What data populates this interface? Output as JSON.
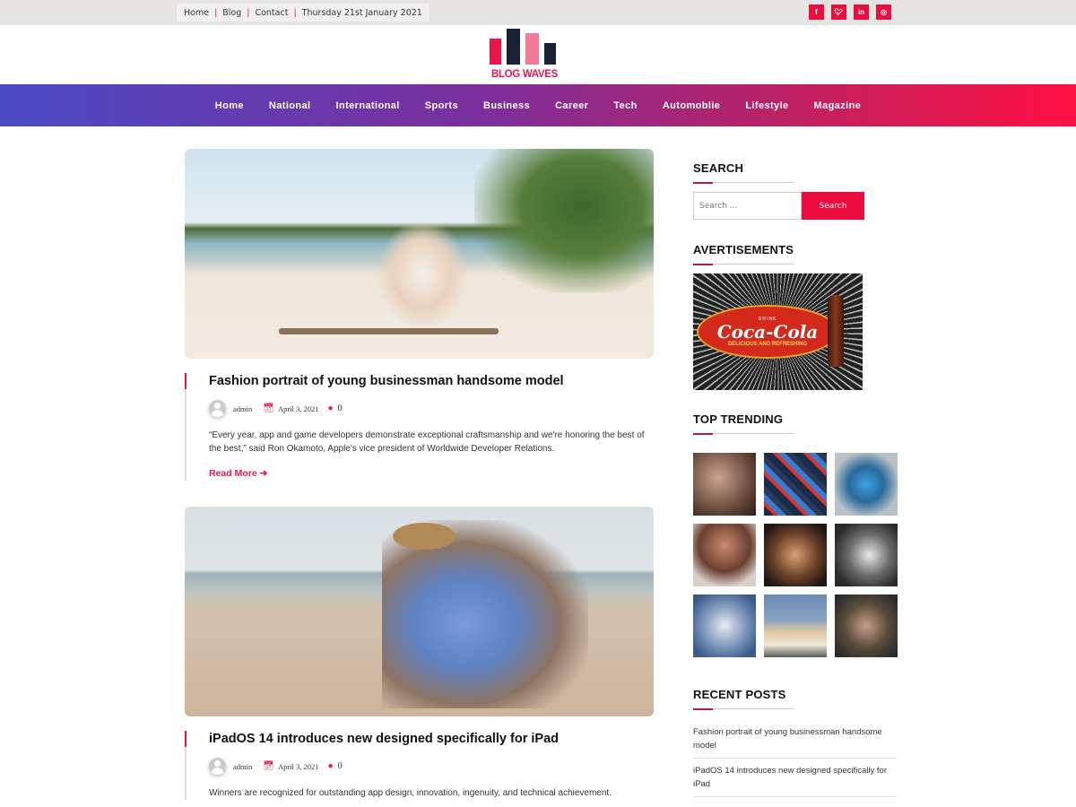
{
  "topbar": {
    "links": [
      "Home",
      "Blog",
      "Contact"
    ],
    "date": "Thursday 21st January 2021",
    "social": [
      {
        "icon": "facebook-icon",
        "glyph": "f"
      },
      {
        "icon": "twitter-icon",
        "glyph": "t"
      },
      {
        "icon": "linkedin-icon",
        "glyph": "in"
      },
      {
        "icon": "instagram-icon",
        "glyph": "◎"
      }
    ]
  },
  "logo": {
    "text": "BLOG WAVES",
    "colors": [
      "#e8174a",
      "#1b2236",
      "#f17a96",
      "#1b2236"
    ]
  },
  "nav": [
    "Home",
    "National",
    "International",
    "Sports",
    "Business",
    "Career",
    "Tech",
    "Automoblie",
    "Lifestyle",
    "Magazine"
  ],
  "posts": [
    {
      "title": "Fashion portrait of young businessman handsome model",
      "author": "admin",
      "date": "April 3, 2021",
      "comments": "0",
      "excerpt": "“Every year, app and game developers demonstrate exceptional craftsmanship and we're honoring the best of the best,” said Ron Okamoto, Apple's vice president of Worldwide Developer Relations.",
      "read_more": "Read More"
    },
    {
      "title": "iPadOS 14 introduces new designed specifically for iPad",
      "author": "admin",
      "date": "April 3, 2021",
      "comments": "0",
      "excerpt": "Winners are recognized for outstanding app design, innovation, ingenuity, and technical achievement."
    }
  ],
  "sidebar": {
    "search_title": "SEARCH",
    "search_placeholder": "Search ...",
    "search_button": "Search",
    "ads_title": "AVERTISEMENTS",
    "ad": {
      "drink": "DRINK",
      "brand": "Coca-Cola",
      "tagline": "DELICIOUS AND REFRESHING"
    },
    "trending_title": "TOP TRENDING",
    "recent_title": "RECENT POSTS",
    "recent_posts": [
      "Fashion portrait of young businessman handsome model",
      "iPadOS 14 introduces new designed specifically for iPad"
    ]
  },
  "accent_color": "#e8174a"
}
